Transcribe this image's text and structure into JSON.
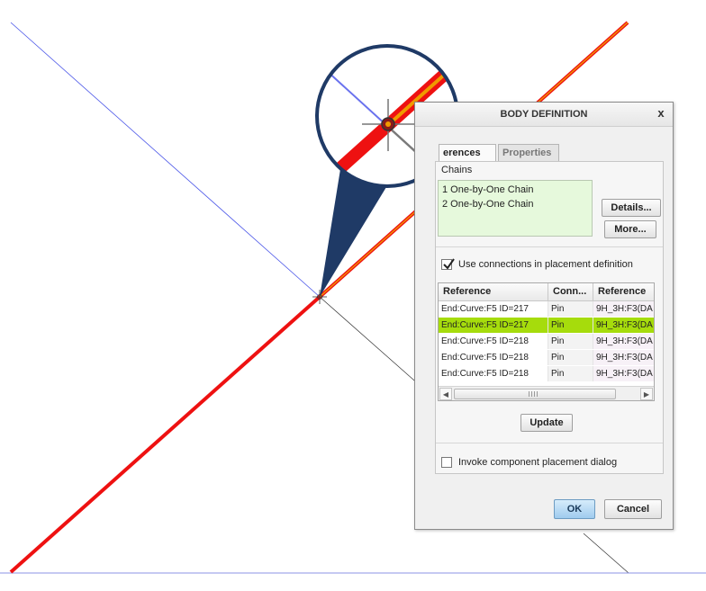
{
  "dialog": {
    "title": "BODY DEFINITION",
    "close_label": "x",
    "tabs": [
      {
        "label": "erences",
        "active": true
      },
      {
        "label": "Properties",
        "active": false
      }
    ],
    "chains_label": "Chains",
    "chains": [
      "1 One-by-One Chain",
      "2 One-by-One Chain"
    ],
    "details_label": "Details...",
    "more_label": "More...",
    "use_connections": {
      "label": "Use connections in placement definition",
      "checked": true
    },
    "table": {
      "headers": [
        "Reference",
        "Conn...",
        "Reference"
      ],
      "rows": [
        {
          "ref": "End:Curve:F5 ID=217",
          "conn": "Pin",
          "ref2": "9H_3H:F3(DA",
          "selected": false
        },
        {
          "ref": "End:Curve:F5 ID=217",
          "conn": "Pin",
          "ref2": "9H_3H:F3(DA",
          "selected": true
        },
        {
          "ref": "End:Curve:F5 ID=218",
          "conn": "Pin",
          "ref2": "9H_3H:F3(DA",
          "selected": false
        },
        {
          "ref": "End:Curve:F5 ID=218",
          "conn": "Pin",
          "ref2": "9H_3H:F3(DA",
          "selected": false
        },
        {
          "ref": "End:Curve:F5 ID=218",
          "conn": "Pin",
          "ref2": "9H_3H:F3(DA",
          "selected": false
        }
      ]
    },
    "update_label": "Update",
    "invoke_placement": {
      "label": "Invoke component placement dialog",
      "checked": false
    },
    "ok_label": "OK",
    "cancel_label": "Cancel"
  },
  "colors": {
    "selected_row": "#a6dc0c",
    "chains_bg": "#e6f9dc",
    "red_curve": "#ee1111",
    "orange_curve": "#f09a00",
    "blue_line": "#4a55e8",
    "callout": "#1f3a66"
  },
  "icons": {
    "checkmark": "checkmark-icon",
    "scroll_left": "chevron-left-icon",
    "scroll_right": "chevron-right-icon"
  }
}
